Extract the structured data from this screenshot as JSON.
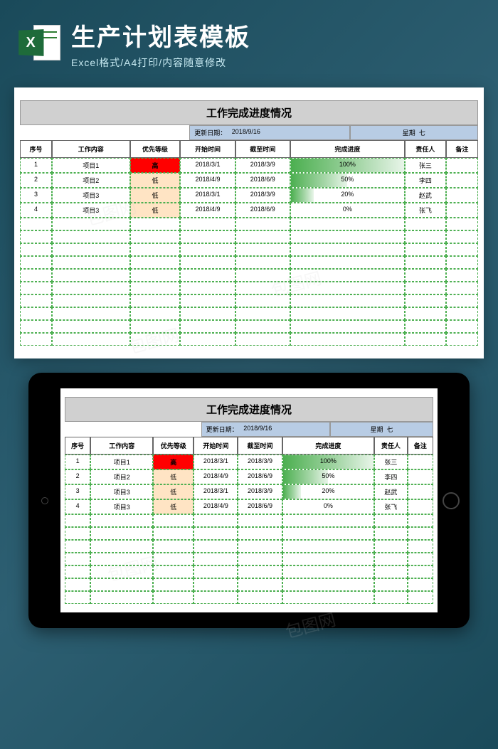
{
  "header": {
    "title": "生产计划表模板",
    "subtitle": "Excel格式/A4打印/内容随意修改",
    "icon_letter": "X"
  },
  "sheet": {
    "title": "工作完成进度情况",
    "update_label": "更新日期：",
    "update_date": "2018/9/16",
    "weekday_label": "星期",
    "weekday_value": "七",
    "columns": [
      "序号",
      "工作内容",
      "优先等级",
      "开始时间",
      "截至时间",
      "完成进度",
      "责任人",
      "备注"
    ],
    "rows": [
      {
        "no": "1",
        "task": "项目1",
        "priority": "高",
        "priority_lvl": "high",
        "start": "2018/3/1",
        "end": "2018/3/9",
        "progress": 100,
        "progress_label": "100%",
        "owner": "张三",
        "note": ""
      },
      {
        "no": "2",
        "task": "项目2",
        "priority": "低",
        "priority_lvl": "low",
        "start": "2018/4/9",
        "end": "2018/6/9",
        "progress": 50,
        "progress_label": "50%",
        "owner": "李四",
        "note": ""
      },
      {
        "no": "3",
        "task": "项目3",
        "priority": "低",
        "priority_lvl": "low",
        "start": "2018/3/1",
        "end": "2018/3/9",
        "progress": 20,
        "progress_label": "20%",
        "owner": "赵武",
        "note": ""
      },
      {
        "no": "4",
        "task": "项目3",
        "priority": "低",
        "priority_lvl": "low",
        "start": "2018/4/9",
        "end": "2018/6/9",
        "progress": 0,
        "progress_label": "0%",
        "owner": "张飞",
        "note": ""
      }
    ],
    "empty_rows": 10
  },
  "colors": {
    "priority_high": "#ff0000",
    "priority_low": "#ffe4c4",
    "progress_bar": "#4caf50"
  }
}
